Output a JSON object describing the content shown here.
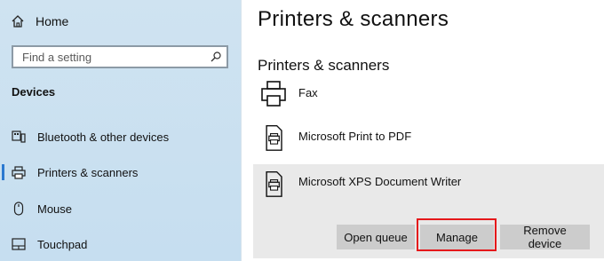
{
  "sidebar": {
    "home_label": "Home",
    "search_placeholder": "Find a setting",
    "section_label": "Devices",
    "items": [
      {
        "label": "Bluetooth & other devices",
        "icon": "bluetooth-devices-icon"
      },
      {
        "label": "Printers & scanners",
        "icon": "printer-icon",
        "active": true
      },
      {
        "label": "Mouse",
        "icon": "mouse-icon"
      },
      {
        "label": "Touchpad",
        "icon": "touchpad-icon"
      }
    ]
  },
  "main": {
    "title": "Printers & scanners",
    "section_title": "Printers & scanners",
    "printers": [
      {
        "name": "Fax",
        "icon": "fax-printer-icon"
      },
      {
        "name": "Microsoft Print to PDF",
        "icon": "document-printer-icon"
      },
      {
        "name": "Microsoft XPS Document Writer",
        "icon": "document-printer-icon",
        "selected": true
      }
    ],
    "buttons": {
      "open_queue": "Open queue",
      "manage": "Manage",
      "remove_device": "Remove device"
    }
  },
  "colors": {
    "sidebar_bg": "#c6def0",
    "accent": "#2b79d0",
    "highlight_box": "#e5181b",
    "button_bg": "#cccccc",
    "selected_row_bg": "#e9e9e9"
  }
}
